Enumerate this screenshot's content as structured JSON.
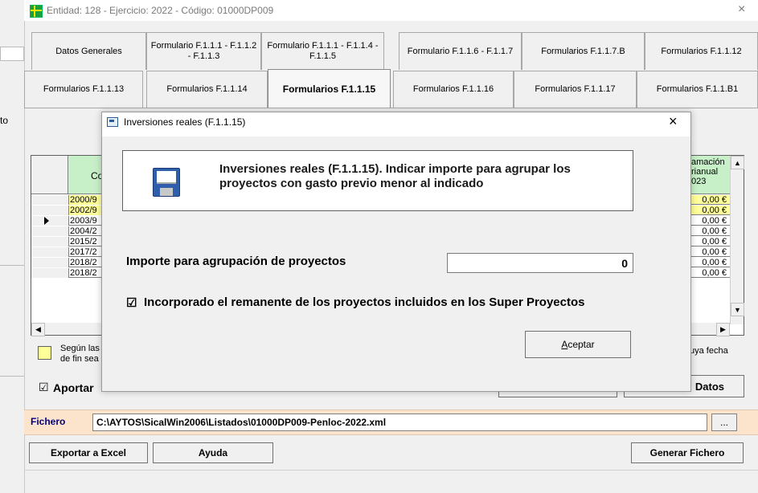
{
  "window": {
    "title": "Entidad: 128 - Ejercicio: 2022 - Código: 01000DP009",
    "close": "×"
  },
  "tabs_top": [
    "Datos Generales",
    "Formulario F.1.1.1 - F.1.1.2 - F.1.1.3",
    "Formulario F.1.1.1 - F.1.1.4 - F.1.1.5",
    "Formulario F.1.1.6 - F.1.1.7",
    "Formularios F.1.1.7.B",
    "Formularios F.1.1.12"
  ],
  "tabs_bottom": [
    "Formularios F.1.1.13",
    "Formularios F.1.1.14",
    "Formularios F.1.1.15",
    "Formularios F.1.1.16",
    "Formularios F.1.1.17",
    "Formularios F.1.1.B1"
  ],
  "active_tab": "Formularios F.1.1.15",
  "side_label": "to",
  "grid": {
    "col_code_head": "Co",
    "right_head": "amación rianual 023",
    "rows": [
      {
        "code": "2000/9",
        "value": "0,00 €",
        "highlight": true
      },
      {
        "code": "2002/9",
        "value": "0,00 €",
        "highlight": true
      },
      {
        "code": "2003/9",
        "value": "0,00 €",
        "highlight": false,
        "current": true
      },
      {
        "code": "2004/2",
        "value": "0,00 €",
        "highlight": false
      },
      {
        "code": "2015/2",
        "value": "0,00 €",
        "highlight": false
      },
      {
        "code": "2017/2",
        "value": "0,00 €",
        "highlight": false
      },
      {
        "code": "2018/2",
        "value": "0,00 €",
        "highlight": false
      },
      {
        "code": "2018/2",
        "value": "0,00 €",
        "highlight": false
      }
    ]
  },
  "legend_text": "Según las\nde fin sea",
  "legend_right": "uya fecha",
  "aportar_label": "Aportar",
  "datos_button": "Datos",
  "fichero": {
    "label": "Fichero",
    "path": "C:\\AYTOS\\SicalWin2006\\Listados\\01000DP009-Penloc-2022.xml",
    "browse": "..."
  },
  "bottom_buttons": {
    "export": "Exportar a Excel",
    "help": "Ayuda",
    "generate": "Generar Fichero"
  },
  "dialog": {
    "title": "Inversiones reales (F.1.1.15)",
    "close": "×",
    "banner": "Inversiones reales (F.1.1.15). Indicar importe para agrupar los proyectos con gasto previo menor al indicado",
    "importe_label": "Importe para agrupación de proyectos",
    "importe_value": "0",
    "checkbox_label": "Incorporado el remanente de los proyectos incluidos en los Super Proyectos",
    "checkbox_checked": true,
    "accept_prefix": "A",
    "accept_rest": "ceptar"
  }
}
